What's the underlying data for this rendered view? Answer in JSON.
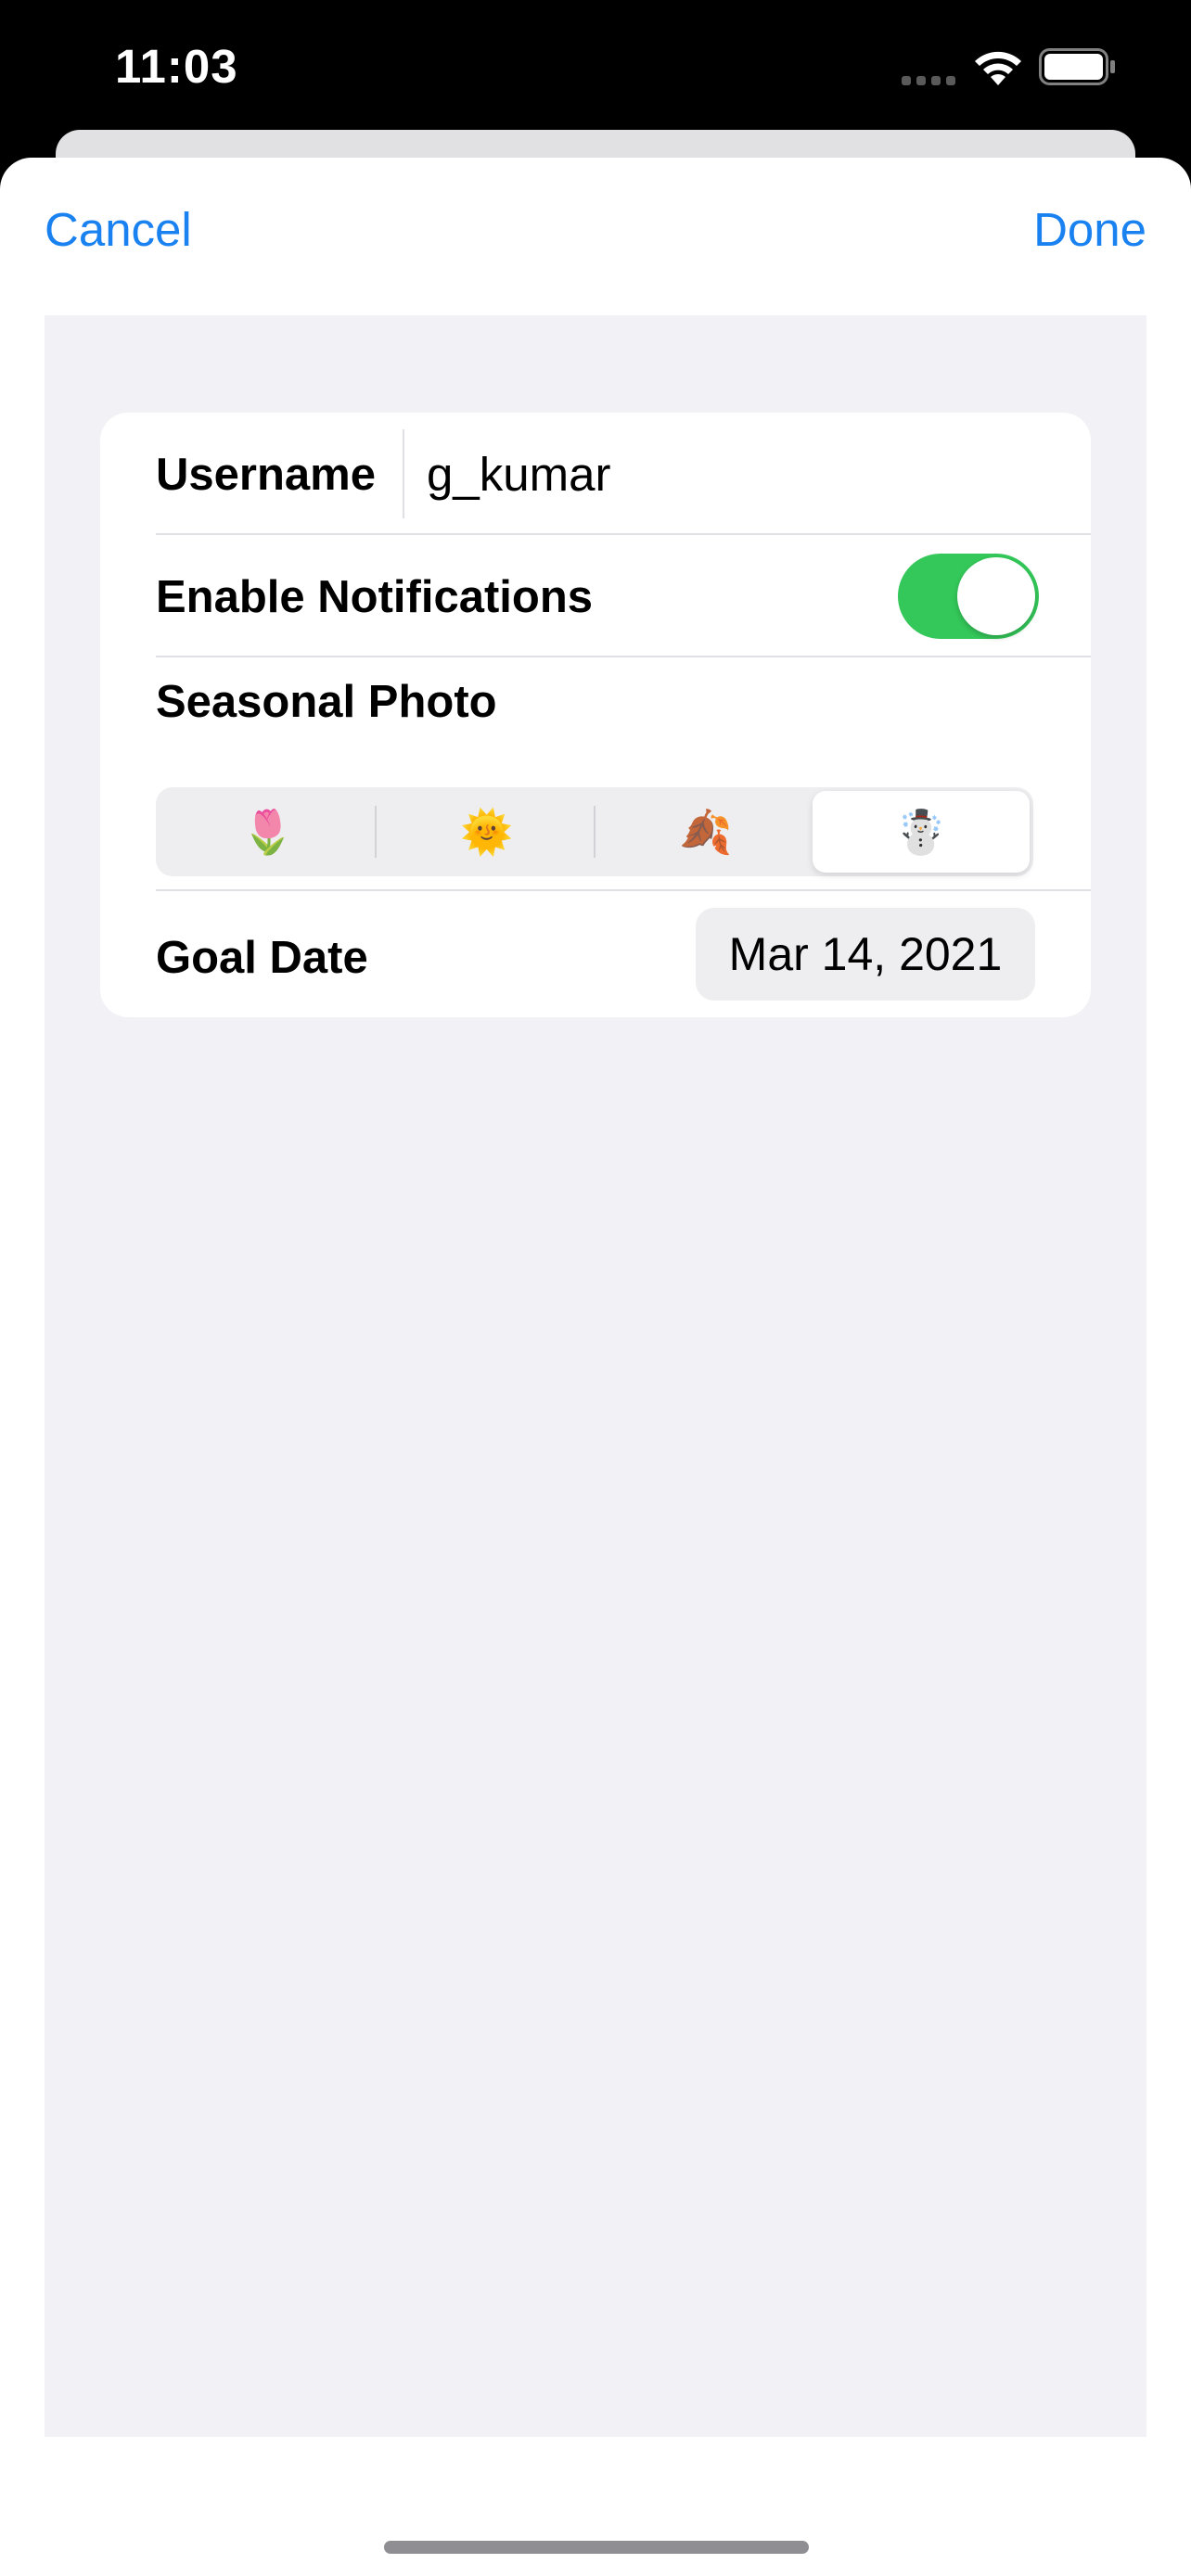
{
  "status_bar": {
    "time": "11:03",
    "icons": [
      "signal-icon",
      "wifi-icon",
      "battery-icon"
    ]
  },
  "nav": {
    "cancel_label": "Cancel",
    "done_label": "Done"
  },
  "form": {
    "username_label": "Username",
    "username_value": "g_kumar",
    "notifications_label": "Enable Notifications",
    "notifications_enabled": true,
    "seasonal_label": "Seasonal Photo",
    "seasons": [
      {
        "emoji": "🌷",
        "name": "spring",
        "selected": false
      },
      {
        "emoji": "🌞",
        "name": "summer",
        "selected": false
      },
      {
        "emoji": "🍂",
        "name": "autumn",
        "selected": false
      },
      {
        "emoji": "☃️",
        "name": "winter",
        "selected": true
      }
    ],
    "goal_date_label": "Goal Date",
    "goal_date_value": "Mar 14, 2021"
  },
  "colors": {
    "accent": "#1a82f0",
    "toggle_on": "#34c759",
    "form_background": "#f1f1f6"
  }
}
